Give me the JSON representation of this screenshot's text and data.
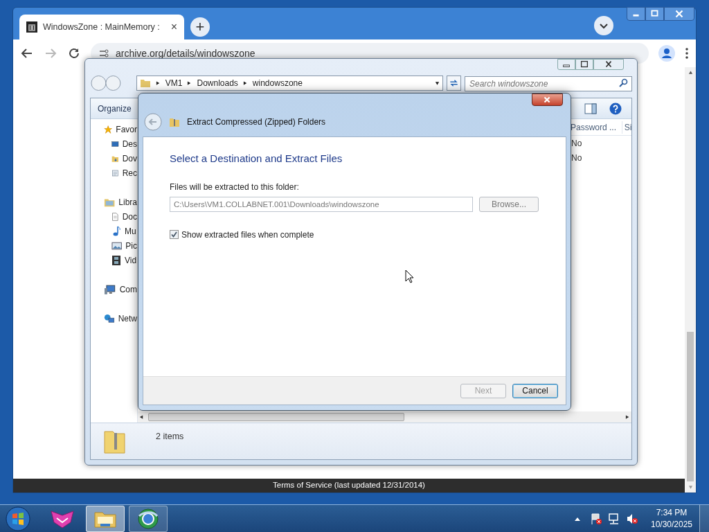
{
  "browser": {
    "tab": {
      "title": "WindowsZone : MainMemory :",
      "close": "×"
    },
    "new_tab": "+",
    "url": "archive.org/details/windowszone",
    "forward_disabled": true,
    "footer": "Terms of Service (last updated 12/31/2014)"
  },
  "explorer": {
    "breadcrumbs": [
      "VM1",
      "Downloads",
      "windowszone"
    ],
    "search_placeholder": "Search windowszone",
    "toolbar": [
      "Organize"
    ],
    "nav": [
      {
        "label": "Favor",
        "kind": "star",
        "children": [
          {
            "label": "Des",
            "kind": "desktop"
          },
          {
            "label": "Dov",
            "kind": "downloads"
          },
          {
            "label": "Rec",
            "kind": "recent"
          }
        ]
      },
      {
        "label": "Libra",
        "kind": "library",
        "children": [
          {
            "label": "Doc",
            "kind": "document"
          },
          {
            "label": "Mu",
            "kind": "music"
          },
          {
            "label": "Pic",
            "kind": "pictures"
          },
          {
            "label": "Vid",
            "kind": "video"
          }
        ]
      },
      {
        "label": "Com",
        "kind": "computer"
      },
      {
        "label": "Netw",
        "kind": "network"
      }
    ],
    "columns": [
      "Password ...",
      "Si"
    ],
    "rows": [
      [
        "No"
      ],
      [
        "No"
      ]
    ],
    "status": "2 items"
  },
  "dialog": {
    "title": "Extract Compressed (Zipped) Folders",
    "heading": "Select a Destination and Extract Files",
    "field_label": "Files will be extracted to this folder:",
    "path": "C:\\Users\\VM1.COLLABNET.001\\Downloads\\windowszone",
    "browse": "Browse...",
    "checkbox": {
      "label": "Show extracted files when complete",
      "checked": true
    },
    "buttons": [
      {
        "label": "Next",
        "disabled": true
      },
      {
        "label": "Cancel",
        "disabled": false
      }
    ]
  },
  "taskbar": {
    "apps": [
      {
        "kind": "fox",
        "selected": false
      },
      {
        "kind": "folder",
        "selected": true
      },
      {
        "kind": "globe",
        "selected": false
      }
    ],
    "time": "7:34 PM",
    "date": "10/30/2025"
  }
}
